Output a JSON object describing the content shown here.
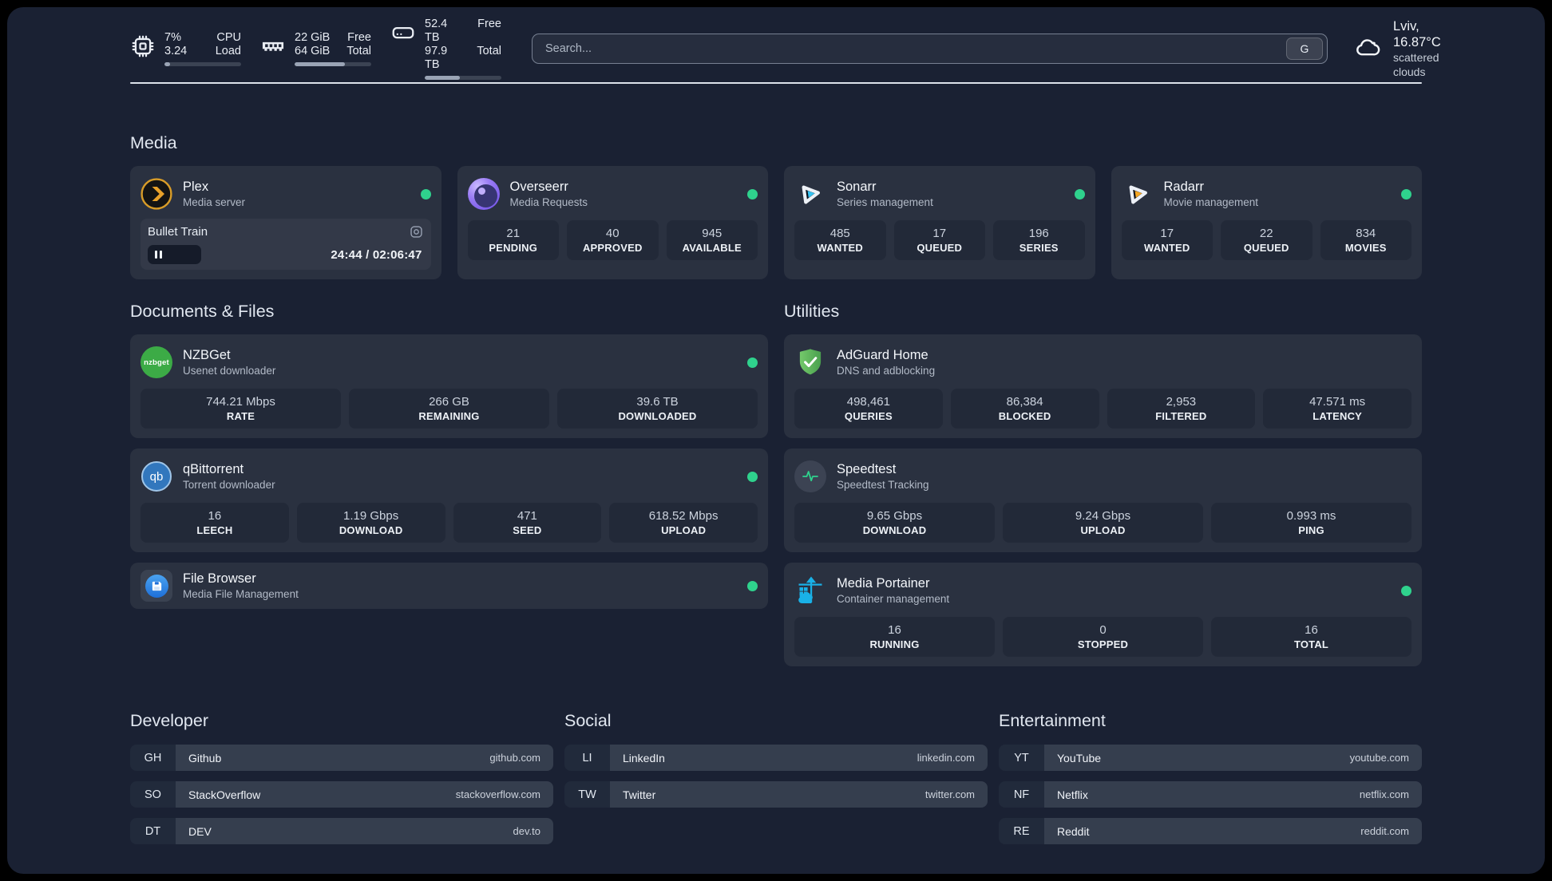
{
  "colors": {
    "page_bg": "#1a2133",
    "card_bg": "#2a3140",
    "tile_bg": "#222938",
    "status_online": "#2fd28d",
    "plex_amber": "#e8a12a",
    "sonarr_blue": "#36c3f2",
    "radarr_amber": "#f4a622",
    "portainer_blue": "#19b1e7",
    "adguard_green": "#5cb85c"
  },
  "topbar": {
    "cpu": {
      "value": "7%",
      "load": "3.24",
      "label_top": "CPU",
      "label_bottom": "Load",
      "usage_pct": 7
    },
    "memory": {
      "free": "22 GiB",
      "total": "64 GiB",
      "label_top": "Free",
      "label_bottom": "Total",
      "usage_pct": 66
    },
    "disk": {
      "free": "52.4 TB",
      "total": "97.9 TB",
      "label_top": "Free",
      "label_bottom": "Total",
      "usage_pct": 46
    },
    "search": {
      "placeholder": "Search...",
      "provider_key": "G"
    },
    "weather": {
      "location": "Lviv, 16.87°C",
      "condition": "scattered clouds"
    }
  },
  "sections": {
    "media": {
      "title": "Media",
      "cards": [
        {
          "name": "Plex",
          "description": "Media server",
          "online": true,
          "now_playing": {
            "title": "Bullet Train",
            "time_display": "24:44 / 02:06:47",
            "progress_pct": 19.5
          }
        },
        {
          "name": "Overseerr",
          "description": "Media Requests",
          "online": true,
          "stats": [
            {
              "value": "21",
              "label": "PENDING"
            },
            {
              "value": "40",
              "label": "APPROVED"
            },
            {
              "value": "945",
              "label": "AVAILABLE"
            }
          ]
        },
        {
          "name": "Sonarr",
          "description": "Series management",
          "online": true,
          "stats": [
            {
              "value": "485",
              "label": "WANTED"
            },
            {
              "value": "17",
              "label": "QUEUED"
            },
            {
              "value": "196",
              "label": "SERIES"
            }
          ]
        },
        {
          "name": "Radarr",
          "description": "Movie management",
          "online": true,
          "stats": [
            {
              "value": "17",
              "label": "WANTED"
            },
            {
              "value": "22",
              "label": "QUEUED"
            },
            {
              "value": "834",
              "label": "MOVIES"
            }
          ]
        }
      ]
    },
    "documents": {
      "title": "Documents & Files",
      "cards": [
        {
          "name": "NZBGet",
          "description": "Usenet downloader",
          "online": true,
          "icon_text": "nzbget",
          "stats": [
            {
              "value": "744.21 Mbps",
              "label": "RATE"
            },
            {
              "value": "266 GB",
              "label": "REMAINING"
            },
            {
              "value": "39.6 TB",
              "label": "DOWNLOADED"
            }
          ]
        },
        {
          "name": "qBittorrent",
          "description": "Torrent downloader",
          "online": true,
          "icon_text": "qb",
          "stats": [
            {
              "value": "16",
              "label": "LEECH"
            },
            {
              "value": "1.19 Gbps",
              "label": "DOWNLOAD"
            },
            {
              "value": "471",
              "label": "SEED"
            },
            {
              "value": "618.52 Mbps",
              "label": "UPLOAD"
            }
          ]
        },
        {
          "name": "File Browser",
          "description": "Media File Management",
          "online": true
        }
      ]
    },
    "utilities": {
      "title": "Utilities",
      "cards": [
        {
          "name": "AdGuard Home",
          "description": "DNS and adblocking",
          "stats": [
            {
              "value": "498,461",
              "label": "QUERIES"
            },
            {
              "value": "86,384",
              "label": "BLOCKED"
            },
            {
              "value": "2,953",
              "label": "FILTERED"
            },
            {
              "value": "47.571 ms",
              "label": "LATENCY"
            }
          ]
        },
        {
          "name": "Speedtest",
          "description": "Speedtest Tracking",
          "stats": [
            {
              "value": "9.65 Gbps",
              "label": "DOWNLOAD"
            },
            {
              "value": "9.24 Gbps",
              "label": "UPLOAD"
            },
            {
              "value": "0.993 ms",
              "label": "PING"
            }
          ]
        },
        {
          "name": "Media Portainer",
          "description": "Container management",
          "online": true,
          "stats": [
            {
              "value": "16",
              "label": "RUNNING"
            },
            {
              "value": "0",
              "label": "STOPPED"
            },
            {
              "value": "16",
              "label": "TOTAL"
            }
          ]
        }
      ]
    },
    "bookmarks": [
      {
        "title": "Developer",
        "links": [
          {
            "abbr": "GH",
            "name": "Github",
            "href": "github.com"
          },
          {
            "abbr": "SO",
            "name": "StackOverflow",
            "href": "stackoverflow.com"
          },
          {
            "abbr": "DT",
            "name": "DEV",
            "href": "dev.to"
          }
        ]
      },
      {
        "title": "Social",
        "links": [
          {
            "abbr": "LI",
            "name": "LinkedIn",
            "href": "linkedin.com"
          },
          {
            "abbr": "TW",
            "name": "Twitter",
            "href": "twitter.com"
          }
        ]
      },
      {
        "title": "Entertainment",
        "links": [
          {
            "abbr": "YT",
            "name": "YouTube",
            "href": "youtube.com"
          },
          {
            "abbr": "NF",
            "name": "Netflix",
            "href": "netflix.com"
          },
          {
            "abbr": "RE",
            "name": "Reddit",
            "href": "reddit.com"
          }
        ]
      }
    ]
  }
}
